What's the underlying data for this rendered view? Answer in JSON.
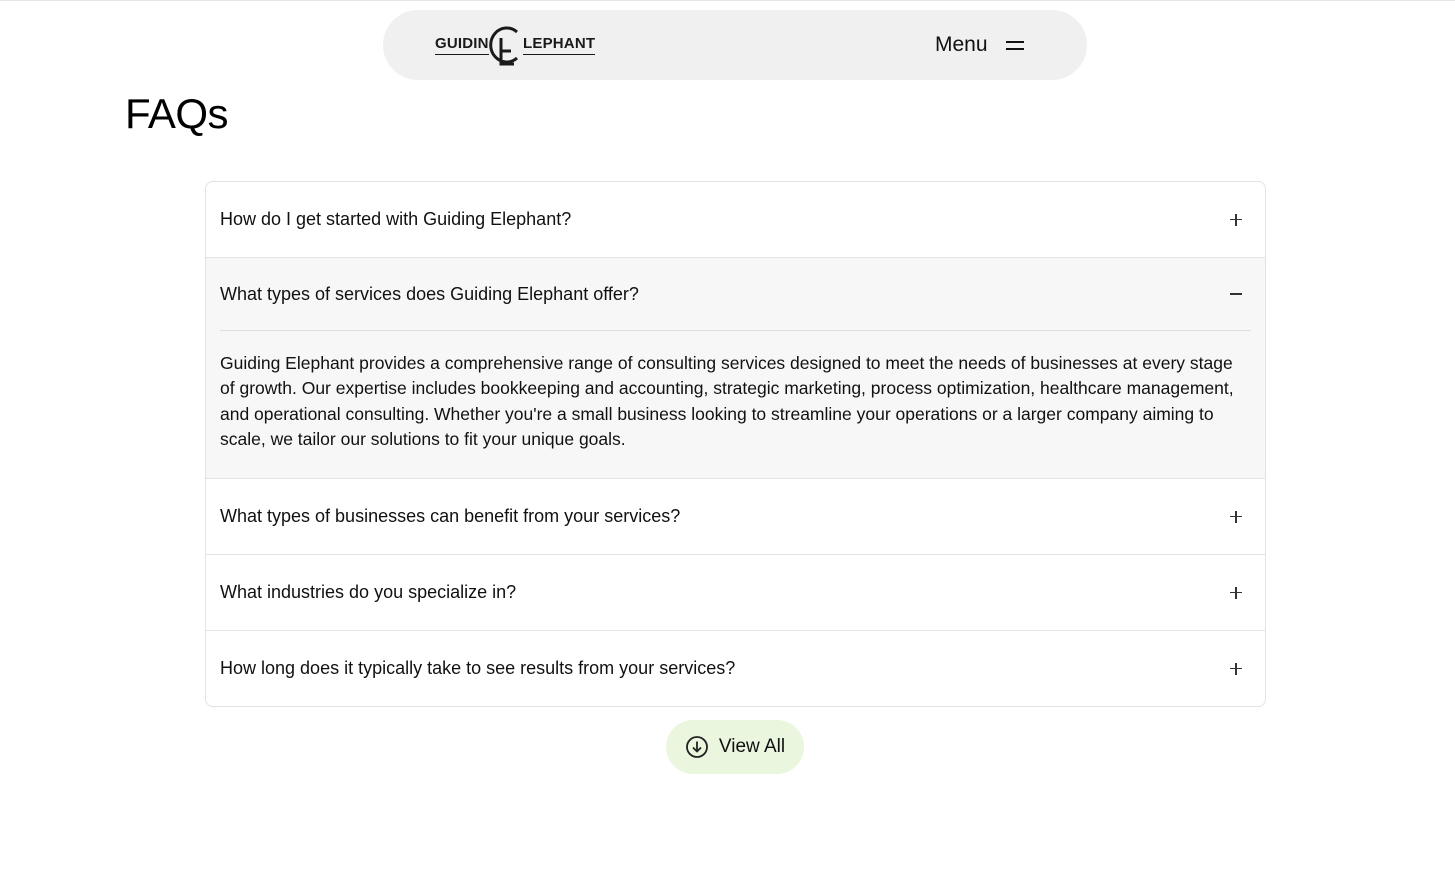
{
  "header": {
    "logo": {
      "text_left": "GUIDIN",
      "text_right": "LEPHANT"
    },
    "menu_label": "Menu"
  },
  "main": {
    "title": "FAQs",
    "faqs": [
      {
        "question": "How do I get started with Guiding Elephant?",
        "expanded": false,
        "answer": ""
      },
      {
        "question": "What types of services does Guiding Elephant offer?",
        "expanded": true,
        "answer": "Guiding Elephant provides a comprehensive range of consulting services designed to meet the needs of businesses at every stage of growth. Our expertise includes bookkeeping and accounting, strategic marketing, process optimization, healthcare management, and operational consulting. Whether you're a small business looking to streamline your operations or a larger company aiming to scale, we tailor our solutions to fit your unique goals."
      },
      {
        "question": "What types of businesses can benefit from your services?",
        "expanded": false,
        "answer": ""
      },
      {
        "question": "What industries do you specialize in?",
        "expanded": false,
        "answer": ""
      },
      {
        "question": "How long does it typically take to see results from your services?",
        "expanded": false,
        "answer": ""
      }
    ],
    "view_all_label": "View All"
  },
  "colors": {
    "nav_bg": "#f0f0f0",
    "open_item_bg": "#f7f7f7",
    "view_all_bg": "#eaf6de",
    "border": "#e3e3e3"
  },
  "icons": {
    "menu": "hamburger-icon",
    "collapsed": "plus-icon",
    "expanded": "minus-icon",
    "view_all": "arrow-down-circle-icon"
  }
}
